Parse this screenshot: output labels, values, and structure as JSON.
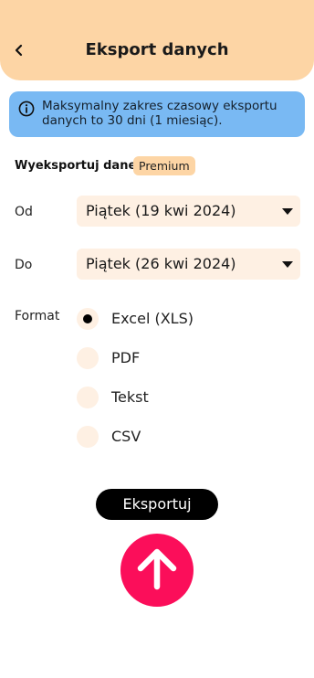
{
  "header": {
    "title": "Eksport danych",
    "back_icon": "chevron-left-icon"
  },
  "info_banner": {
    "icon": "info-icon",
    "text": "Maksymalny zakres czasowy eksportu danych to 30 dni (1 miesiąc)."
  },
  "export_section": {
    "label": "Wyeksportuj dane",
    "badge": "Premium"
  },
  "from_field": {
    "label": "Od",
    "value": "Piątek (19 kwi 2024)"
  },
  "to_field": {
    "label": "Do",
    "value": "Piątek (26 kwi 2024)"
  },
  "format": {
    "label": "Format",
    "selected": "Excel (XLS)",
    "options": [
      {
        "label": "Excel (XLS)",
        "selected": true
      },
      {
        "label": "PDF",
        "selected": false
      },
      {
        "label": "Tekst",
        "selected": false
      },
      {
        "label": "CSV",
        "selected": false
      }
    ]
  },
  "actions": {
    "export_label": "Eksportuj",
    "upload_icon": "arrow-up-icon"
  },
  "colors": {
    "header_bg": "#fdd5a5",
    "info_bg": "#79b9f3",
    "field_bg": "#fef0e3",
    "accent": "#fb0e5a",
    "button_bg": "#000000"
  }
}
